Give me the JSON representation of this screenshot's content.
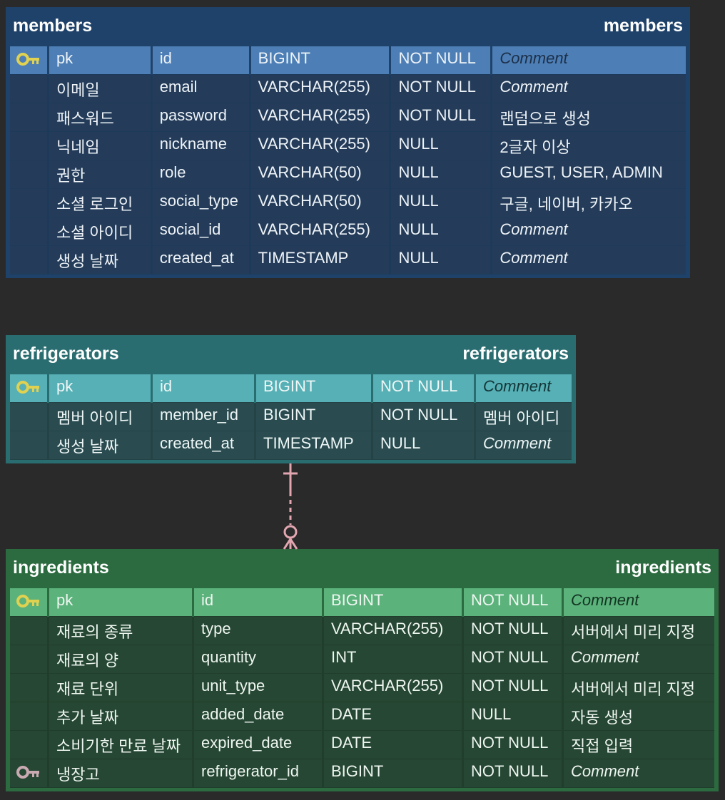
{
  "colors": {
    "members_header": "#1f426a",
    "members_pk_row": "#4d7fb6",
    "refrigerators_header": "#2a6d71",
    "refrigerators_pk_row": "#56b0b5",
    "ingredients_header": "#2b6b3f",
    "ingredients_pk_row": "#5bb27b",
    "primary_key_icon": "#e0d150",
    "foreign_key_icon": "#c9aab3",
    "relationship_line": "#e3a6b1"
  },
  "tables": {
    "members": {
      "name_left": "members",
      "name_right": "members",
      "rows": [
        {
          "key": "pk",
          "logical": "pk",
          "physical": "id",
          "type": "BIGINT",
          "nullable": "NOT NULL",
          "comment": "Comment",
          "comment_placeholder": true
        },
        {
          "key": "",
          "logical": "이메일",
          "physical": "email",
          "type": "VARCHAR(255)",
          "nullable": "NOT NULL",
          "comment": "Comment",
          "comment_placeholder": true
        },
        {
          "key": "",
          "logical": "패스워드",
          "physical": "password",
          "type": "VARCHAR(255)",
          "nullable": "NOT NULL",
          "comment": "랜덤으로 생성",
          "comment_placeholder": false
        },
        {
          "key": "",
          "logical": "닉네임",
          "physical": "nickname",
          "type": "VARCHAR(255)",
          "nullable": "NULL",
          "comment": "2글자 이상",
          "comment_placeholder": false
        },
        {
          "key": "",
          "logical": "권한",
          "physical": "role",
          "type": "VARCHAR(50)",
          "nullable": "NULL",
          "comment": "GUEST, USER, ADMIN",
          "comment_placeholder": false
        },
        {
          "key": "",
          "logical": "소셜 로그인",
          "physical": "social_type",
          "type": "VARCHAR(50)",
          "nullable": "NULL",
          "comment": "구글, 네이버, 카카오",
          "comment_placeholder": false
        },
        {
          "key": "",
          "logical": "소셜 아이디",
          "physical": "social_id",
          "type": "VARCHAR(255)",
          "nullable": "NULL",
          "comment": "Comment",
          "comment_placeholder": true
        },
        {
          "key": "",
          "logical": "생성 날짜",
          "physical": "created_at",
          "type": "TIMESTAMP",
          "nullable": "NULL",
          "comment": "Comment",
          "comment_placeholder": true
        }
      ]
    },
    "refrigerators": {
      "name_left": "refrigerators",
      "name_right": "refrigerators",
      "rows": [
        {
          "key": "pk",
          "logical": "pk",
          "physical": "id",
          "type": "BIGINT",
          "nullable": "NOT NULL",
          "comment": "Comment",
          "comment_placeholder": true
        },
        {
          "key": "",
          "logical": "멤버 아이디",
          "physical": "member_id",
          "type": "BIGINT",
          "nullable": "NOT NULL",
          "comment": "멤버 아이디",
          "comment_placeholder": false
        },
        {
          "key": "",
          "logical": "생성 날짜",
          "physical": "created_at",
          "type": "TIMESTAMP",
          "nullable": "NULL",
          "comment": "Comment",
          "comment_placeholder": true
        }
      ]
    },
    "ingredients": {
      "name_left": "ingredients",
      "name_right": "ingredients",
      "rows": [
        {
          "key": "pk",
          "logical": "pk",
          "physical": "id",
          "type": "BIGINT",
          "nullable": "NOT NULL",
          "comment": "Comment",
          "comment_placeholder": true
        },
        {
          "key": "",
          "logical": "재료의 종류",
          "physical": "type",
          "type": "VARCHAR(255)",
          "nullable": "NOT NULL",
          "comment": "서버에서 미리 지정",
          "comment_placeholder": false
        },
        {
          "key": "",
          "logical": "재료의 양",
          "physical": "quantity",
          "type": "INT",
          "nullable": "NOT NULL",
          "comment": "Comment",
          "comment_placeholder": true
        },
        {
          "key": "",
          "logical": "재료 단위",
          "physical": "unit_type",
          "type": "VARCHAR(255)",
          "nullable": "NOT NULL",
          "comment": "서버에서 미리 지정",
          "comment_placeholder": false
        },
        {
          "key": "",
          "logical": "추가 날짜",
          "physical": "added_date",
          "type": "DATE",
          "nullable": "NULL",
          "comment": "자동 생성",
          "comment_placeholder": false
        },
        {
          "key": "",
          "logical": "소비기한 만료 날짜",
          "physical": "expired_date",
          "type": "DATE",
          "nullable": "NOT NULL",
          "comment": "직접 입력",
          "comment_placeholder": false
        },
        {
          "key": "fk",
          "logical": "냉장고",
          "physical": "refrigerator_id",
          "type": "BIGINT",
          "nullable": "NOT NULL",
          "comment": "Comment",
          "comment_placeholder": true
        }
      ]
    }
  }
}
